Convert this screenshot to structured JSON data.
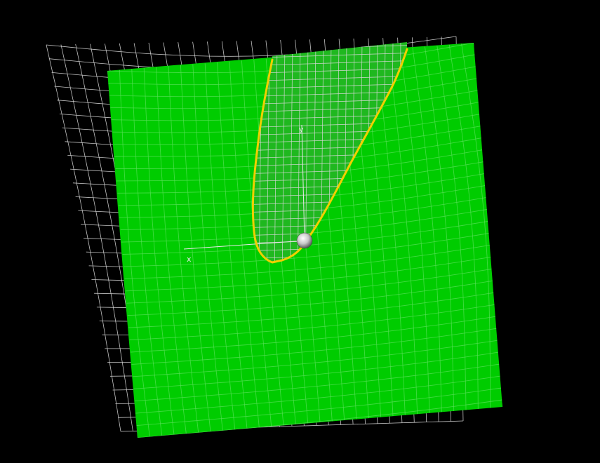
{
  "scene": {
    "background_color": "#000000",
    "surface_color": "#00cc00",
    "surface_mesh_color": "#55e055",
    "wire_grid_color": "#d8d8d8",
    "curve_color": "#f0d000",
    "axis_color": "#e8e8e8",
    "point_color": "#f4f4f4"
  },
  "axes": {
    "x_label": "x",
    "y_label": "y"
  }
}
